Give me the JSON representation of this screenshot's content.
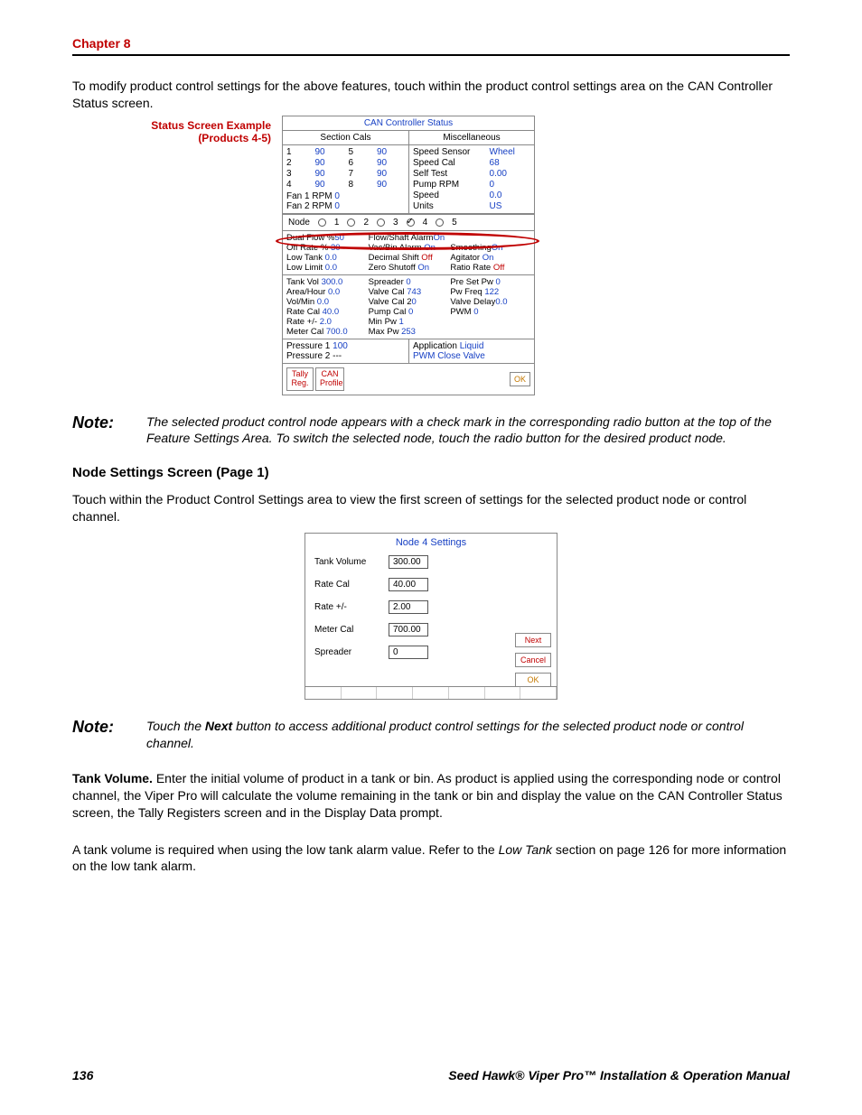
{
  "chapter": "Chapter 8",
  "intro_text": "To modify product control settings for the above features, touch within the product control settings area on the CAN Controller Status screen.",
  "fig1_label_line1": "Status Screen Example",
  "fig1_label_line2": "(Products 4-5)",
  "can": {
    "title": "CAN Controller Status",
    "section_cals_title": "Section Cals",
    "misc_title": "Miscellaneous",
    "sc": {
      "r1": "1",
      "v1": "90",
      "r5": "5",
      "v5": "90",
      "r2": "2",
      "v2": "90",
      "r6": "6",
      "v6": "90",
      "r3": "3",
      "v3": "90",
      "r7": "7",
      "v7": "90",
      "r4": "4",
      "v4": "90",
      "r8": "8",
      "v8": "90"
    },
    "fan1_l": "Fan 1 RPM",
    "fan1_v": "0",
    "fan2_l": "Fan 2 RPM",
    "fan2_v": "0",
    "misc": {
      "speed_sensor_l": "Speed Sensor",
      "speed_sensor_v": "Wheel",
      "speed_cal_l": "Speed Cal",
      "speed_cal_v": "68",
      "self_test_l": "Self Test",
      "self_test_v": "0.00",
      "pump_rpm_l": "Pump RPM",
      "pump_rpm_v": "0",
      "speed_l": "Speed",
      "speed_v": "0.0",
      "units_l": "Units",
      "units_v": "US"
    },
    "node_label": "Node",
    "nodes": [
      "1",
      "2",
      "3",
      "4",
      "5"
    ],
    "selected_node": "4",
    "flow_block": {
      "dual_flow_l": "Dual Flow %",
      "dual_flow_v": "50",
      "off_rate_l": "Off Rate %",
      "off_rate_v": "30",
      "low_tank_l": "Low Tank",
      "low_tank_v": "0.0",
      "low_limit_l": "Low Limit",
      "low_limit_v": "0.0",
      "flow_alarm_l": "Flow/Shaft Alarm",
      "flow_alarm_v": "On",
      "vac_bin_l": "Vac/Bin Alarm",
      "vac_bin_v": "On",
      "dec_shift_l": "Decimal Shift",
      "dec_shift_v": "Off",
      "zero_l": "Zero Shutoff",
      "zero_v": "On",
      "smoothing_l": "Smoothing",
      "smoothing_v": "On",
      "agitator_l": "Agitator",
      "agitator_v": "On",
      "ratio_l": "Ratio Rate",
      "ratio_v": "Off"
    },
    "tank_block": {
      "tank_vol_l": "Tank Vol",
      "tank_vol_v": "300.0",
      "area_hr_l": "Area/Hour",
      "area_hr_v": "0.0",
      "vol_min_l": "Vol/Min",
      "vol_min_v": "0.0",
      "rate_cal_l": "Rate Cal",
      "rate_cal_v": "40.0",
      "rate_pm_l": "Rate +/-",
      "rate_pm_v": "2.0",
      "meter_cal_l": "Meter Cal",
      "meter_cal_v": "700.0",
      "spreader_l": "Spreader",
      "spreader_v": "0",
      "valve_cal_l": "Valve Cal",
      "valve_cal_v": "743",
      "valve_cal2_l": "Valve Cal 2",
      "valve_cal2_v": "0",
      "pump_cal_l": "Pump Cal",
      "pump_cal_v": "0",
      "min_pw_l": "Min Pw",
      "min_pw_v": "1",
      "max_pw_l": "Max Pw",
      "max_pw_v": "253",
      "preset_l": "Pre Set Pw",
      "preset_v": "0",
      "pw_freq_l": "Pw Freq",
      "pw_freq_v": "122",
      "valve_delay_l": "Valve Delay",
      "valve_delay_v": "0.0",
      "pwm_l": "PWM",
      "pwm_v": "0"
    },
    "pressure1_l": "Pressure 1",
    "pressure1_v": "100",
    "pressure2_l": "Pressure 2",
    "pressure2_v": "---",
    "app_l": "Application",
    "app_v": "Liquid",
    "pwm_cv": "PWM Close Valve",
    "btn_tally": "Tally Reg.",
    "btn_can": "CAN Profile",
    "btn_ok": "OK"
  },
  "note1_label": "Note:",
  "note1_text": "The selected product control node appears with a check mark in the corresponding radio button at the top of the Feature Settings Area. To switch the selected node, touch the radio button for the desired product node.",
  "section_heading": "Node Settings Screen (Page 1)",
  "section_text": "Touch within the Product Control Settings area to view the first screen of settings for the selected product node or control channel.",
  "node_settings": {
    "title": "Node 4 Settings",
    "fields": {
      "tank_vol_l": "Tank Volume",
      "tank_vol_v": "300.00",
      "rate_cal_l": "Rate Cal",
      "rate_cal_v": "40.00",
      "rate_pm_l": "Rate +/-",
      "rate_pm_v": "2.00",
      "meter_cal_l": "Meter Cal",
      "meter_cal_v": "700.00",
      "spreader_l": "Spreader",
      "spreader_v": "0"
    },
    "btn_next": "Next",
    "btn_cancel": "Cancel",
    "btn_ok": "OK"
  },
  "note2_label": "Note:",
  "note2_text_a": "Touch the ",
  "note2_text_b": "Next",
  "note2_text_c": " button to access additional product control settings for the selected product node or control channel.",
  "tank_heading": "Tank Volume. ",
  "tank_p1": "Enter the initial volume of product in a tank or bin. As product is applied using the corresponding node or control channel, the Viper Pro will calculate the volume remaining in the tank or bin and display the value on the CAN Controller Status screen, the Tally Registers screen and in the Display Data prompt.",
  "tank_p2_a": "A tank volume is required when using the low tank alarm value. Refer to the ",
  "tank_p2_b": "Low Tank",
  "tank_p2_c": " section on page 126 for more information on the low tank alarm.",
  "footer_page": "136",
  "footer_title": "Seed Hawk® Viper Pro™ Installation & Operation Manual"
}
